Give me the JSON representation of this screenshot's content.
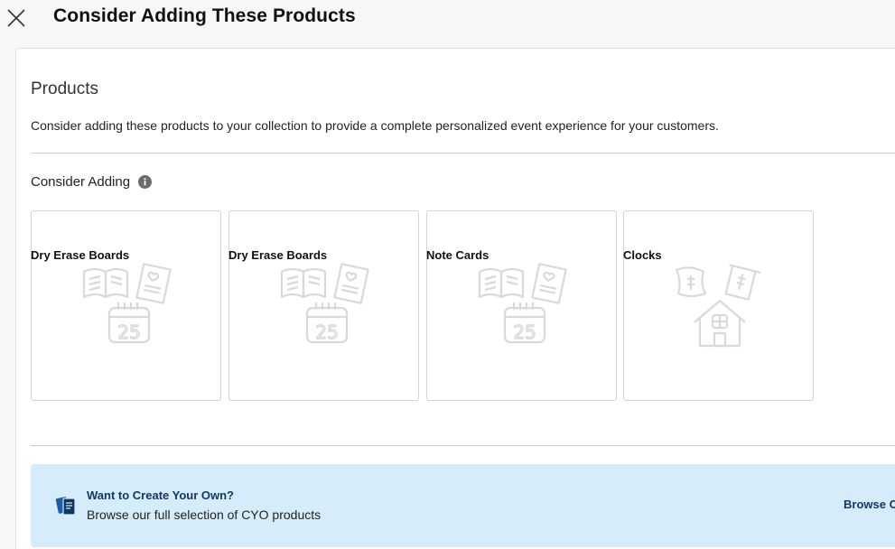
{
  "header": {
    "title": "Consider Adding These Products",
    "close_icon": "close-icon"
  },
  "panel": {
    "section_title": "Products",
    "description": "Consider adding these products to your collection to provide a complete personalized event experience for your customers.",
    "consider_label": "Consider Adding",
    "info_icon": "info-icon"
  },
  "products": [
    {
      "label": "Dry Erase Boards",
      "icon": "event-stationery-icon"
    },
    {
      "label": "Dry Erase Boards",
      "icon": "event-stationery-icon"
    },
    {
      "label": "Note Cards",
      "icon": "event-stationery-icon"
    },
    {
      "label": "Clocks",
      "icon": "home-decor-icon"
    }
  ],
  "banner": {
    "title": "Want to Create Your Own?",
    "subtitle": "Browse our full selection of CYO products",
    "link": "Browse C",
    "icon": "cards-icon",
    "background": "#d6ecfb",
    "accent": "#10365f"
  }
}
